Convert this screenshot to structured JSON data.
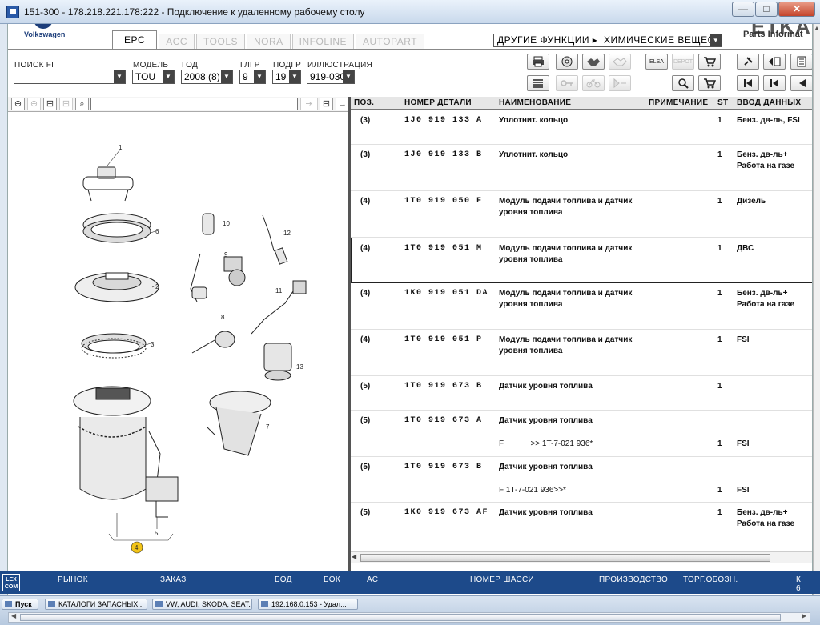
{
  "window": {
    "title": "151-300 - 178.218.221.178:222 - Подключение к удаленному рабочему столу"
  },
  "brand": {
    "name": "Volkswagen",
    "product_big": "ETKA",
    "product_sub": "Parts Informat"
  },
  "tabs": [
    {
      "label": "EPC",
      "active": true
    },
    {
      "label": "ACC",
      "active": false
    },
    {
      "label": "TOOLS",
      "active": false
    },
    {
      "label": "NORA",
      "active": false
    },
    {
      "label": "INFOLINE",
      "active": false
    },
    {
      "label": "AUTOPART",
      "active": false
    }
  ],
  "top_menu": {
    "other_functions": "ДРУГИЕ ФУНКЦИИ ▸",
    "chemistry_select": "ХИМИЧЕСКИЕ ВЕЩЕСТВА"
  },
  "filters": {
    "search": {
      "label": "ПОИСК FI",
      "value": ""
    },
    "model": {
      "label": "МОДЕЛЬ",
      "value": "TOU"
    },
    "year": {
      "label": "ГОД",
      "value": "2008 (8)"
    },
    "main_group": {
      "label": "ГЛГР",
      "value": "9"
    },
    "sub_group": {
      "label": "ПОДГР",
      "value": "19"
    },
    "illustration": {
      "label": "ИЛЛЮСТРАЦИЯ",
      "value": "919-030"
    }
  },
  "toolbar_icons": {
    "row1": [
      "print-icon",
      "cd-icon",
      "handshake-icon",
      "handshake-disabled-icon",
      "elsa-icon",
      "depot-icon",
      "cart-add-icon",
      "pin-icon",
      "page-back-icon",
      "page-list-icon"
    ],
    "row2": [
      "list-view-icon",
      "key-icon",
      "bicycle-icon",
      "play-disabled-icon",
      "lens-icon",
      "cart-icon",
      "first-page-icon",
      "prev-page-icon",
      "prev-icon"
    ],
    "elsa_label": "ELSA",
    "depot_label": "DEPOT"
  },
  "table": {
    "headers": {
      "pos": "ПОЗ.",
      "part_number": "НОМЕР ДЕТАЛИ",
      "name": "НАИМЕНОВАНИЕ",
      "note": "ПРИМЕЧАНИЕ",
      "st": "ST",
      "input": "ВВОД ДАННЫХ"
    },
    "rows": [
      {
        "pos": "(3)",
        "part": "1J0 919 133 A",
        "name": "Уплотнит. кольцо",
        "sub": "",
        "st": "1",
        "input": "Бенз. дв-ль, FSI"
      },
      {
        "pos": "(3)",
        "part": "1J0 919 133 B",
        "name": "Уплотнит. кольцо",
        "sub": "",
        "st": "1",
        "input": "Бенз. дв-ль+ Работа на газе"
      },
      {
        "pos": "(4)",
        "part": "1T0 919 050 F",
        "name": "Модуль подачи топлива и датчик уровня топлива",
        "sub": "",
        "st": "1",
        "input": "Дизель"
      },
      {
        "pos": "(4)",
        "part": "1T0 919 051 M",
        "name": "Модуль подачи топлива и датчик уровня топлива",
        "sub": "",
        "st": "1",
        "input": "ДВС"
      },
      {
        "pos": "(4)",
        "part": "1K0 919 051 DA",
        "name": "Модуль подачи топлива и датчик уровня топлива",
        "sub": "",
        "st": "1",
        "input": "Бенз. дв-ль+ Работа на газе"
      },
      {
        "pos": "(4)",
        "part": "1T0 919 051 P",
        "name": "Модуль подачи топлива и датчик уровня топлива",
        "sub": "",
        "st": "1",
        "input": "FSI"
      },
      {
        "pos": "(5)",
        "part": "1T0 919 673 B",
        "name": "Датчик уровня топлива",
        "sub": "",
        "st": "1",
        "input": ""
      },
      {
        "pos": "(5)",
        "part": "1T0 919 673 A",
        "name": "Датчик уровня топлива",
        "sub": "F            >> 1T-7-021 936*",
        "st": "1",
        "input": "FSI"
      },
      {
        "pos": "(5)",
        "part": "1T0 919 673 B",
        "name": "Датчик уровня топлива",
        "sub": "F 1T-7-021 936>>*",
        "st": "1",
        "input": "FSI"
      },
      {
        "pos": "(5)",
        "part": "1K0 919 673 AF",
        "name": "Датчик уровня топлива",
        "sub": "",
        "st": "1",
        "input": "Бенз. дв-ль+ Работа на газе"
      }
    ]
  },
  "illustration": {
    "callouts": [
      "1",
      "6",
      "2",
      "3",
      "10",
      "12",
      "9",
      "11",
      "8",
      "13",
      "7",
      "5",
      "4"
    ]
  },
  "status_bar": {
    "logo": "LEX COM",
    "labels": [
      "РЫНОК",
      "ЗАКАЗ",
      "БОД",
      "БОК",
      "АС",
      "НОМЕР ШАССИ",
      "ПРОИЗВОДСТВО",
      "ТОРГ.ОБОЗН.",
      "К 6"
    ]
  },
  "taskbar": {
    "items": [
      "Пуск",
      "КАТАЛОГИ ЗАПАСНЫХ...",
      "VW, AUDI, SKODA, SEAT...",
      "192.168.0.153 - Удал..."
    ]
  }
}
